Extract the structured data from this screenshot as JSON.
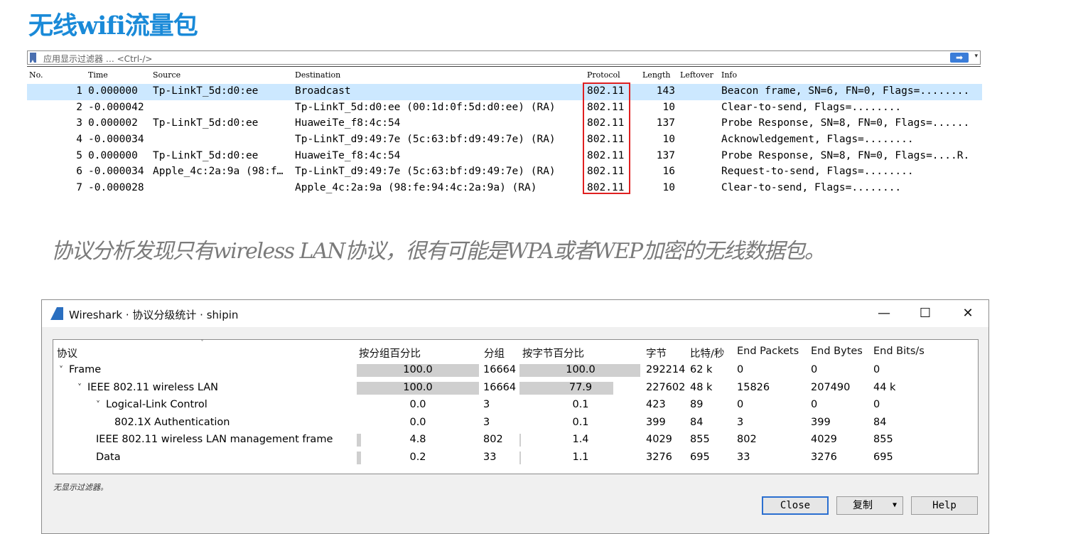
{
  "slide": {
    "title": "无线wifi流量包",
    "caption": "协议分析发现只有wireless LAN协议，很有可能是WPA或者WEP加密的无线数据包。"
  },
  "packet_list": {
    "filter_placeholder": "应用显示过滤器 … <Ctrl-/>",
    "apply_icon": "arrow-right-icon",
    "columns": [
      "No.",
      "Time",
      "Source",
      "Destination",
      "Protocol",
      "Length",
      "Leftover",
      "Info"
    ],
    "rows": [
      {
        "no": "1",
        "time": "0.000000",
        "source": "Tp-LinkT_5d:d0:ee",
        "destination": "Broadcast",
        "protocol": "802.11",
        "length": "143",
        "info": "Beacon frame, SN=6, FN=0, Flags=........"
      },
      {
        "no": "2",
        "time": "-0.000042",
        "source": "",
        "destination": "Tp-LinkT_5d:d0:ee (00:1d:0f:5d:d0:ee) (RA)",
        "protocol": "802.11",
        "length": "10",
        "info": "Clear-to-send, Flags=........"
      },
      {
        "no": "3",
        "time": "0.000002",
        "source": "Tp-LinkT_5d:d0:ee",
        "destination": "HuaweiTe_f8:4c:54",
        "protocol": "802.11",
        "length": "137",
        "info": "Probe Response, SN=8, FN=0, Flags=......"
      },
      {
        "no": "4",
        "time": "-0.000034",
        "source": "",
        "destination": "Tp-LinkT_d9:49:7e (5c:63:bf:d9:49:7e) (RA)",
        "protocol": "802.11",
        "length": "10",
        "info": "Acknowledgement, Flags=........"
      },
      {
        "no": "5",
        "time": "0.000000",
        "source": "Tp-LinkT_5d:d0:ee",
        "destination": "HuaweiTe_f8:4c:54",
        "protocol": "802.11",
        "length": "137",
        "info": "Probe Response, SN=8, FN=0, Flags=....R."
      },
      {
        "no": "6",
        "time": "-0.000034",
        "source": "Apple_4c:2a:9a (98:f…",
        "destination": "Tp-LinkT_d9:49:7e (5c:63:bf:d9:49:7e) (RA)",
        "protocol": "802.11",
        "length": "16",
        "info": "Request-to-send, Flags=........"
      },
      {
        "no": "7",
        "time": "-0.000028",
        "source": "",
        "destination": "Apple_4c:2a:9a (98:fe:94:4c:2a:9a) (RA)",
        "protocol": "802.11",
        "length": "10",
        "info": "Clear-to-send, Flags=........"
      }
    ],
    "selected_row": 0,
    "highlight_color": "#e02020"
  },
  "dialog": {
    "title": "Wireshark · 协议分级统计 · shipin",
    "controls": {
      "minimize": "—",
      "maximize": "☐",
      "close": "✕"
    },
    "columns": [
      "协议",
      "按分组百分比",
      "分组",
      "按字节百分比",
      "字节",
      "比特/秒",
      "End Packets",
      "End Bytes",
      "End Bits/s"
    ],
    "rows": [
      {
        "depth": 0,
        "expander": "˅",
        "name": "Frame",
        "pkt_pct": "100.0",
        "pkt_pct_value": 100.0,
        "packets": "16664",
        "byte_pct": "100.0",
        "byte_pct_value": 100.0,
        "bytes": "292214",
        "bps": "62 k",
        "end_packets": "0",
        "end_bytes": "0",
        "end_bps": "0"
      },
      {
        "depth": 1,
        "expander": "˅",
        "name": "IEEE 802.11 wireless LAN",
        "pkt_pct": "100.0",
        "pkt_pct_value": 100.0,
        "packets": "16664",
        "byte_pct": "77.9",
        "byte_pct_value": 77.9,
        "bytes": "227602",
        "bps": "48 k",
        "end_packets": "15826",
        "end_bytes": "207490",
        "end_bps": "44 k"
      },
      {
        "depth": 2,
        "expander": "˅",
        "name": "Logical-Link Control",
        "pkt_pct": "0.0",
        "pkt_pct_value": 0.0,
        "packets": "3",
        "byte_pct": "0.1",
        "byte_pct_value": 0.1,
        "bytes": "423",
        "bps": "89",
        "end_packets": "0",
        "end_bytes": "0",
        "end_bps": "0"
      },
      {
        "depth": 3,
        "expander": "",
        "name": "802.1X Authentication",
        "pkt_pct": "0.0",
        "pkt_pct_value": 0.0,
        "packets": "3",
        "byte_pct": "0.1",
        "byte_pct_value": 0.1,
        "bytes": "399",
        "bps": "84",
        "end_packets": "3",
        "end_bytes": "399",
        "end_bps": "84"
      },
      {
        "depth": 2,
        "expander": "",
        "name": "IEEE 802.11 wireless LAN management frame",
        "pkt_pct": "4.8",
        "pkt_pct_value": 4.8,
        "packets": "802",
        "byte_pct": "1.4",
        "byte_pct_value": 1.4,
        "bytes": "4029",
        "bps": "855",
        "end_packets": "802",
        "end_bytes": "4029",
        "end_bps": "855"
      },
      {
        "depth": 2,
        "expander": "",
        "name": "Data",
        "pkt_pct": "0.2",
        "pkt_pct_value": 0.2,
        "packets": "33",
        "byte_pct": "1.1",
        "byte_pct_value": 1.1,
        "bytes": "3276",
        "bps": "695",
        "end_packets": "33",
        "end_bytes": "3276",
        "end_bps": "695"
      }
    ],
    "status": "无显示过滤器。",
    "buttons": {
      "close": "Close",
      "copy": "复制",
      "copy_arrow": "▼",
      "help": "Help"
    }
  }
}
